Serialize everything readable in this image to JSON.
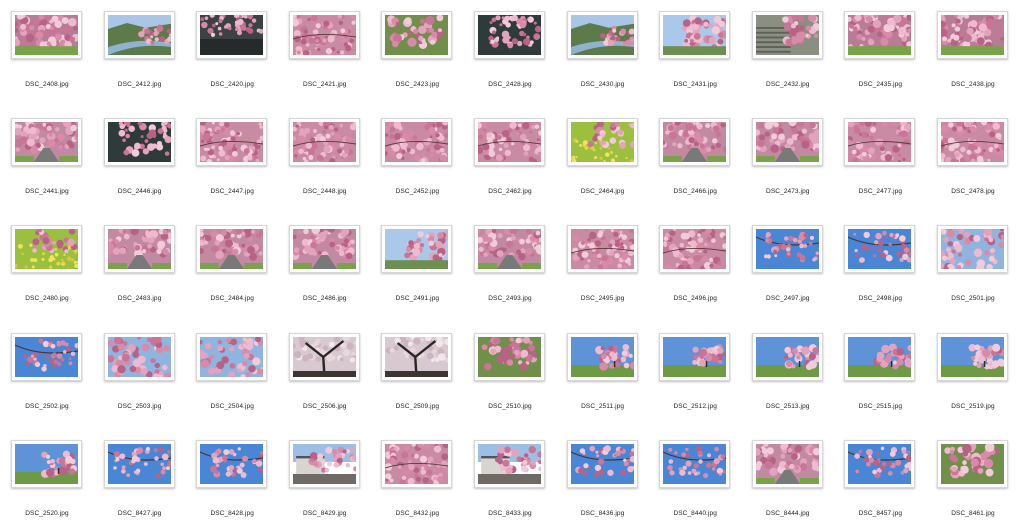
{
  "window": {
    "view": "icon-grid"
  },
  "colors": {
    "background": "#ffffff",
    "label_text": "#222222",
    "thumb_border": "#d6d6d6",
    "sakura_pink": "#d98aa8",
    "sky_blue": "#4a86d6",
    "foliage_green": "#7aa24a"
  },
  "files": [
    {
      "name": "DSC_2408.jpg",
      "scene": "blossom-trees-green"
    },
    {
      "name": "DSC_2412.jpg",
      "scene": "river-landscape"
    },
    {
      "name": "DSC_2420.jpg",
      "scene": "dark-road-trees"
    },
    {
      "name": "DSC_2421.jpg",
      "scene": "blossom-closeup"
    },
    {
      "name": "DSC_2423.jpg",
      "scene": "blossom-green"
    },
    {
      "name": "DSC_2428.jpg",
      "scene": "blossom-dark"
    },
    {
      "name": "DSC_2430.jpg",
      "scene": "river-landscape"
    },
    {
      "name": "DSC_2431.jpg",
      "scene": "sky-blossom-river"
    },
    {
      "name": "DSC_2432.jpg",
      "scene": "steps-blossom"
    },
    {
      "name": "DSC_2435.jpg",
      "scene": "blossom-trees-green"
    },
    {
      "name": "DSC_2438.jpg",
      "scene": "blossom-trees-green"
    },
    {
      "name": "DSC_2441.jpg",
      "scene": "road-blossom"
    },
    {
      "name": "DSC_2446.jpg",
      "scene": "blossom-dark"
    },
    {
      "name": "DSC_2447.jpg",
      "scene": "blossom-closeup"
    },
    {
      "name": "DSC_2448.jpg",
      "scene": "blossom-closeup"
    },
    {
      "name": "DSC_2452.jpg",
      "scene": "blossom-closeup"
    },
    {
      "name": "DSC_2462.jpg",
      "scene": "blossom-closeup"
    },
    {
      "name": "DSC_2464.jpg",
      "scene": "rapeseed-blossom"
    },
    {
      "name": "DSC_2466.jpg",
      "scene": "road-blossom"
    },
    {
      "name": "DSC_2473.jpg",
      "scene": "road-blossom"
    },
    {
      "name": "DSC_2477.jpg",
      "scene": "blossom-closeup"
    },
    {
      "name": "DSC_2478.jpg",
      "scene": "blossom-closeup"
    },
    {
      "name": "DSC_2480.jpg",
      "scene": "rapeseed-blossom"
    },
    {
      "name": "DSC_2483.jpg",
      "scene": "road-blossom"
    },
    {
      "name": "DSC_2484.jpg",
      "scene": "road-blossom"
    },
    {
      "name": "DSC_2486.jpg",
      "scene": "road-blossom"
    },
    {
      "name": "DSC_2491.jpg",
      "scene": "sky-blossom-river"
    },
    {
      "name": "DSC_2493.jpg",
      "scene": "road-blossom"
    },
    {
      "name": "DSC_2495.jpg",
      "scene": "blossom-closeup"
    },
    {
      "name": "DSC_2496.jpg",
      "scene": "blossom-closeup"
    },
    {
      "name": "DSC_2497.jpg",
      "scene": "sky-branch"
    },
    {
      "name": "DSC_2498.jpg",
      "scene": "sky-branch"
    },
    {
      "name": "DSC_2501.jpg",
      "scene": "sky-blossom"
    },
    {
      "name": "DSC_2502.jpg",
      "scene": "sky-branch"
    },
    {
      "name": "DSC_2503.jpg",
      "scene": "sky-blossom"
    },
    {
      "name": "DSC_2504.jpg",
      "scene": "sky-blossom"
    },
    {
      "name": "DSC_2506.jpg",
      "scene": "trunk-dark"
    },
    {
      "name": "DSC_2509.jpg",
      "scene": "trunk-dark"
    },
    {
      "name": "DSC_2510.jpg",
      "scene": "blossom-green"
    },
    {
      "name": "DSC_2511.jpg",
      "scene": "sky-tree-field"
    },
    {
      "name": "DSC_2512.jpg",
      "scene": "sky-tree-field"
    },
    {
      "name": "DSC_2513.jpg",
      "scene": "sky-tree-field"
    },
    {
      "name": "DSC_2515.jpg",
      "scene": "sky-tree-field"
    },
    {
      "name": "DSC_2519.jpg",
      "scene": "sky-tree-field"
    },
    {
      "name": "DSC_2520.jpg",
      "scene": "sky-tree-field"
    },
    {
      "name": "DSC_8427.jpg",
      "scene": "sky-branch"
    },
    {
      "name": "DSC_8428.jpg",
      "scene": "sky-branch"
    },
    {
      "name": "DSC_8429.jpg",
      "scene": "building-tree"
    },
    {
      "name": "DSC_8432.jpg",
      "scene": "blossom-closeup"
    },
    {
      "name": "DSC_8433.jpg",
      "scene": "building-tree"
    },
    {
      "name": "DSC_8436.jpg",
      "scene": "sky-branch"
    },
    {
      "name": "DSC_8440.jpg",
      "scene": "sky-branch"
    },
    {
      "name": "DSC_8444.jpg",
      "scene": "road-blossom"
    },
    {
      "name": "DSC_8457.jpg",
      "scene": "sky-branch"
    },
    {
      "name": "DSC_8461.jpg",
      "scene": "blossom-green"
    }
  ]
}
